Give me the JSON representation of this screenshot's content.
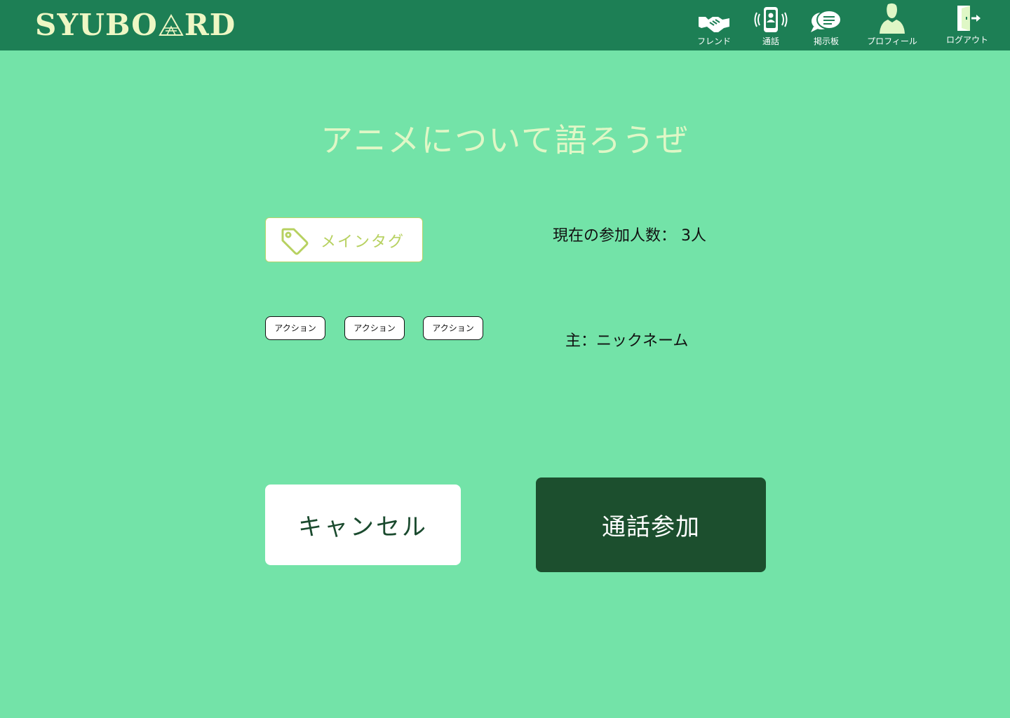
{
  "app": {
    "logo_left": "SYUBO",
    "logo_right": "RD",
    "logo_mark": "logo-triangle-icon"
  },
  "nav": [
    {
      "label": "フレンド",
      "icon": "handshake-icon"
    },
    {
      "label": "通話",
      "icon": "phone-call-icon"
    },
    {
      "label": "掲示板",
      "icon": "chat-bubble-icon"
    },
    {
      "label": "プロフィール",
      "icon": "user-icon"
    },
    {
      "label": "ログアウト",
      "icon": "logout-door-icon"
    }
  ],
  "room": {
    "title": "アニメについて語ろうぜ",
    "main_tag": "メインタグ",
    "participants": "現在の参加人数： 3人",
    "tags": [
      "アクション",
      "アクション",
      "アクション"
    ],
    "host": "主：ニックネーム"
  },
  "actions": {
    "cancel_label": "キャンセル",
    "join_label": "通話参加"
  },
  "colors": {
    "background": "#73e3a8",
    "header": "#1d7f55",
    "join_button": "#1c4f2e",
    "tag_accent": "#b7d160"
  }
}
